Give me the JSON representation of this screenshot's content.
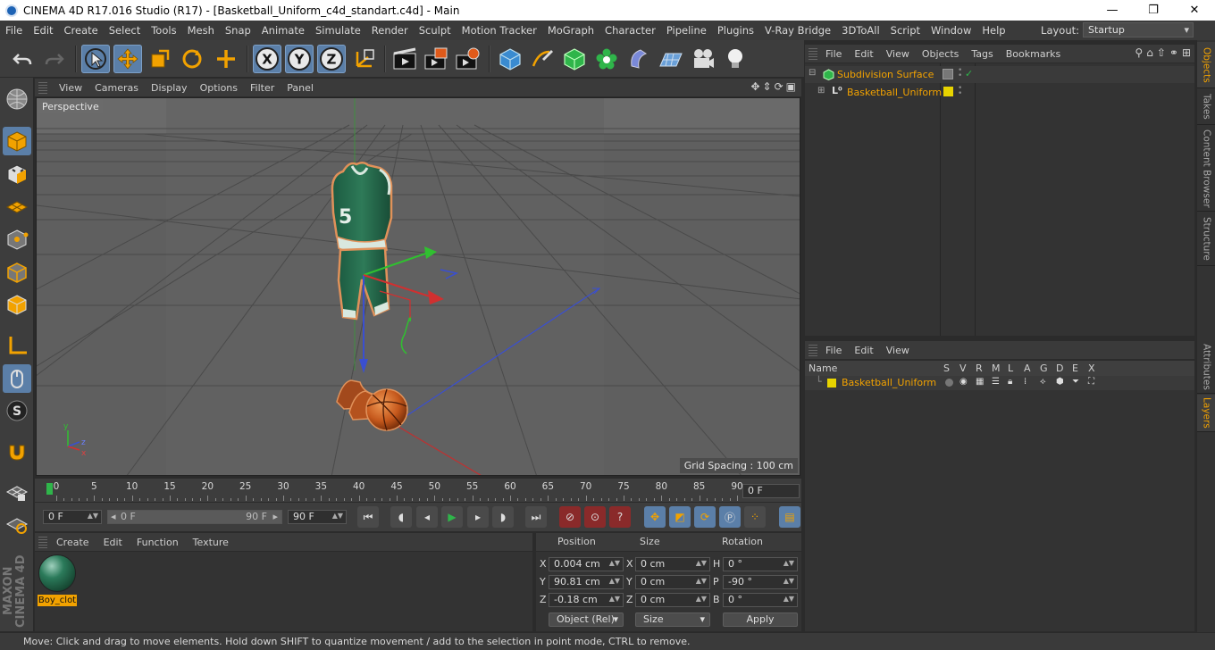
{
  "window": {
    "title": "CINEMA 4D R17.016 Studio (R17) - [Basketball_Uniform_c4d_standart.c4d] - Main",
    "minimize": "—",
    "maximize": "❐",
    "close": "✕"
  },
  "menubar": {
    "items": [
      "File",
      "Edit",
      "Create",
      "Select",
      "Tools",
      "Mesh",
      "Snap",
      "Animate",
      "Simulate",
      "Render",
      "Sculpt",
      "Motion Tracker",
      "MoGraph",
      "Character",
      "Pipeline",
      "Plugins",
      "V-Ray Bridge",
      "3DToAll",
      "Script",
      "Window",
      "Help"
    ],
    "layout_label": "Layout:",
    "layout_value": "Startup"
  },
  "toolbar": {
    "axis_x": "X",
    "axis_y": "Y",
    "axis_z": "Z"
  },
  "viewport": {
    "menu": [
      "View",
      "Cameras",
      "Display",
      "Options",
      "Filter",
      "Panel"
    ],
    "label": "Perspective",
    "grid_spacing": "Grid Spacing : 100 cm",
    "jersey_number": "5",
    "axis_x": "x",
    "axis_y": "y",
    "axis_z": "z"
  },
  "timeline": {
    "ticks": [
      "0",
      "5",
      "10",
      "15",
      "20",
      "25",
      "30",
      "35",
      "40",
      "45",
      "50",
      "55",
      "60",
      "65",
      "70",
      "75",
      "80",
      "85",
      "90"
    ],
    "current_frame": "0 F"
  },
  "playback": {
    "start_field": "0 F",
    "range_start": "0 F",
    "range_end": "90 F",
    "end_field": "90 F"
  },
  "material_manager": {
    "menu": [
      "Create",
      "Edit",
      "Function",
      "Texture"
    ],
    "materials": [
      {
        "name": "Boy_clot"
      }
    ]
  },
  "coordinates": {
    "headers": {
      "position": "Position",
      "size": "Size",
      "rotation": "Rotation"
    },
    "rows": [
      {
        "pos_label": "X",
        "pos": "0.004 cm",
        "size_label": "X",
        "size": "0 cm",
        "rot_label": "H",
        "rot": "0 °"
      },
      {
        "pos_label": "Y",
        "pos": "90.81 cm",
        "size_label": "Y",
        "size": "0 cm",
        "rot_label": "P",
        "rot": "-90 °"
      },
      {
        "pos_label": "Z",
        "pos": "-0.18 cm",
        "size_label": "Z",
        "size": "0 cm",
        "rot_label": "B",
        "rot": "0 °"
      }
    ],
    "mode": "Object (Rel)",
    "size_mode": "Size",
    "apply": "Apply"
  },
  "object_manager": {
    "menu": [
      "File",
      "Edit",
      "View",
      "Objects",
      "Tags",
      "Bookmarks"
    ],
    "objects": [
      {
        "name": "Subdivision Surface",
        "color": "#f2a200"
      },
      {
        "name": "Basketball_Uniform",
        "color": "#f2a200"
      }
    ],
    "check": "✓"
  },
  "layer_manager": {
    "menu": [
      "File",
      "Edit",
      "View"
    ],
    "columns": [
      "Name",
      "S",
      "V",
      "R",
      "M",
      "L",
      "A",
      "G",
      "D",
      "E",
      "X"
    ],
    "layers": [
      {
        "name": "Basketball_Uniform",
        "color": "#e8d400"
      }
    ]
  },
  "right_tabs": [
    "Objects",
    "Takes",
    "Content Browser",
    "Structure",
    "Attributes",
    "Layers"
  ],
  "brand": "MAXON CINEMA 4D",
  "status": "Move: Click and drag to move elements. Hold down SHIFT to quantize movement / add to the selection in point mode, CTRL to remove.",
  "colors": {
    "accent": "#5b7fa8",
    "selected_text": "#f2a200",
    "layer_color": "#e8d400"
  }
}
